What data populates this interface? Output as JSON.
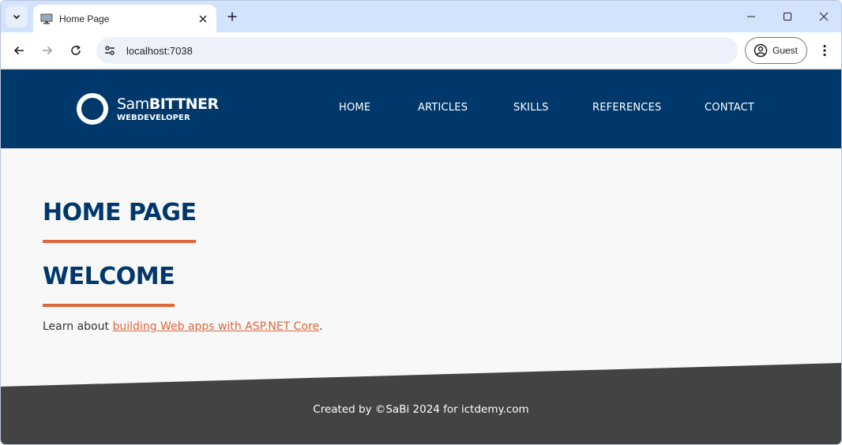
{
  "browser": {
    "tab_title": "Home Page",
    "url": "localhost:7038",
    "profile_label": "Guest",
    "icons": {
      "tab_search": "chevron-down-icon",
      "favicon": "monitor-icon",
      "tab_close": "close-icon",
      "new_tab": "plus-icon",
      "minimize": "minimize-icon",
      "maximize": "maximize-icon",
      "close": "close-icon",
      "back": "arrow-left-icon",
      "forward": "arrow-right-icon",
      "reload": "reload-icon",
      "site_info": "tune-icon",
      "profile": "account-circle-icon",
      "menu": "more-vert-icon"
    }
  },
  "site": {
    "logo": {
      "first": "Sam",
      "last": "BITTNER",
      "subtitle": "WEBDEVELOPER"
    },
    "nav": [
      "HOME",
      "ARTICLES",
      "SKILLS",
      "REFERENCES",
      "CONTACT"
    ],
    "heading": "HOME PAGE",
    "welcome": "WELCOME",
    "body_prefix": "Learn about ",
    "body_link": "building Web apps with ASP.NET Core",
    "body_suffix": ".",
    "footer": "Created by ©SaBi 2024 for ictdemy.com"
  },
  "colors": {
    "header_bg": "#00386b",
    "accent": "#e0673c",
    "footer_bg": "#434343",
    "page_bg": "#f8f8f8",
    "tabstrip_bg": "#d3e3fd"
  }
}
